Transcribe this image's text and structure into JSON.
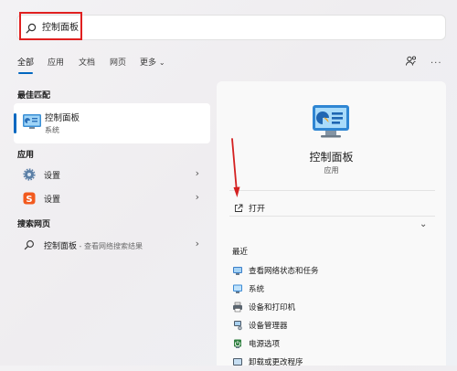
{
  "search": {
    "query": "控制面板"
  },
  "tabs": [
    {
      "label": "全部",
      "active": true
    },
    {
      "label": "应用"
    },
    {
      "label": "文档"
    },
    {
      "label": "网页"
    },
    {
      "label": "更多"
    }
  ],
  "left": {
    "best_match_title": "最佳匹配",
    "best_match": {
      "name": "控制面板",
      "type": "系统"
    },
    "apps_title": "应用",
    "apps": [
      {
        "label": "设置",
        "icon": "gear-icon"
      },
      {
        "label": "设置",
        "icon": "sogou-settings-icon"
      }
    ],
    "web_title": "搜索网页",
    "web_result": {
      "term": "控制面板",
      "suffix": " - 查看网络搜索结果"
    }
  },
  "panel": {
    "app_name": "控制面板",
    "app_type": "应用",
    "open_label": "打开",
    "recent_title": "最近",
    "recent": [
      "查看网络状态和任务",
      "系统",
      "设备和打印机",
      "设备管理器",
      "电源选项",
      "卸载或更改程序"
    ]
  },
  "colors": {
    "accent": "#0067c0",
    "highlight": "#e02020"
  }
}
